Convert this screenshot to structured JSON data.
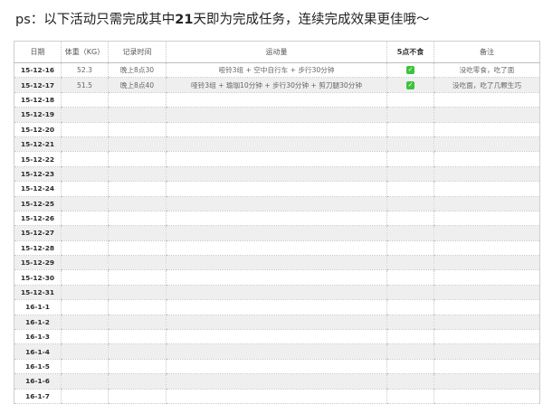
{
  "title": {
    "prefix": "ps：以下活动只需完成其中",
    "days": "21",
    "suffix": "天即为完成任务，连续完成效果更佳哦～"
  },
  "columns": {
    "date": "日期",
    "weight": "体重（KG）",
    "time": "记录时间",
    "exercise": "运动量",
    "no_eat": "5点不食",
    "notes": "备注"
  },
  "rows": [
    {
      "date": "15-12-16",
      "weight": "52.3",
      "time": "晚上8点30",
      "exercise": "哑铃3组 + 空中自行车 + 步行30分钟",
      "no_eat": true,
      "notes": "没吃零食，吃了面"
    },
    {
      "date": "15-12-17",
      "weight": "51.5",
      "time": "晚上8点40",
      "exercise": "哑铃3组 + 瑜珈10分钟 + 步行30分钟 + 剪刀腿30分钟",
      "no_eat": true,
      "notes": "没吃面，吃了几颗生巧"
    },
    {
      "date": "15-12-18"
    },
    {
      "date": "15-12-19"
    },
    {
      "date": "15-12-20"
    },
    {
      "date": "15-12-21"
    },
    {
      "date": "15-12-22"
    },
    {
      "date": "15-12-23"
    },
    {
      "date": "15-12-24"
    },
    {
      "date": "15-12-25"
    },
    {
      "date": "15-12-26"
    },
    {
      "date": "15-12-27"
    },
    {
      "date": "15-12-28"
    },
    {
      "date": "15-12-29"
    },
    {
      "date": "15-12-30"
    },
    {
      "date": "15-12-31"
    },
    {
      "date": "16-1-1"
    },
    {
      "date": "16-1-2"
    },
    {
      "date": "16-1-3"
    },
    {
      "date": "16-1-4"
    },
    {
      "date": "16-1-5"
    },
    {
      "date": "16-1-6"
    },
    {
      "date": "16-1-7"
    }
  ],
  "check_icon": "check-icon",
  "accent_color": "#3cc43c"
}
